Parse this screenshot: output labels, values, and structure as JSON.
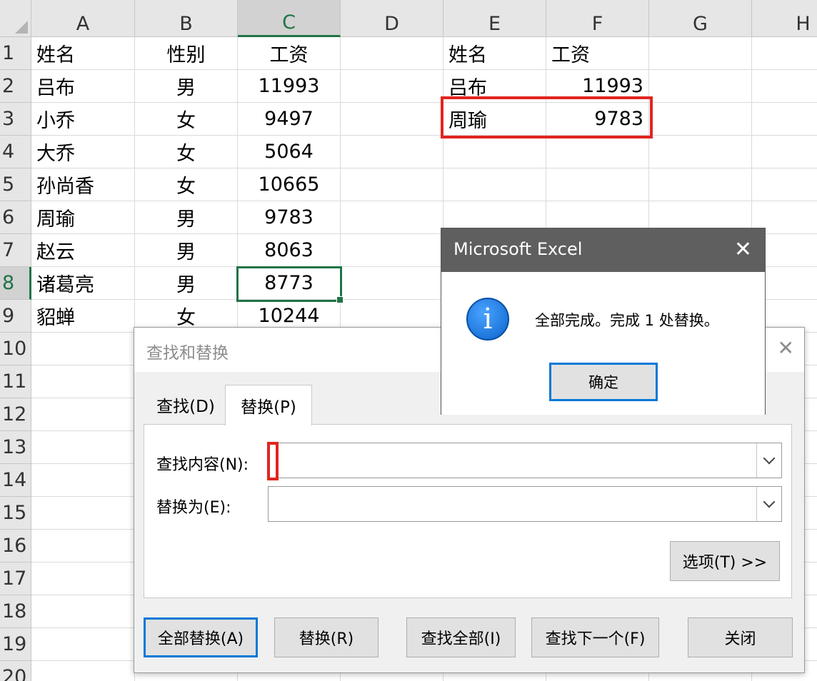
{
  "sheet": {
    "columns": [
      "A",
      "B",
      "C",
      "D",
      "E",
      "F",
      "G",
      "H"
    ],
    "active_column": "C",
    "rows": [
      "1",
      "2",
      "3",
      "4",
      "5",
      "6",
      "7",
      "8",
      "9",
      "10",
      "11",
      "12",
      "13",
      "14",
      "15",
      "16",
      "17",
      "18",
      "19",
      "20"
    ],
    "active_row": "8",
    "table": [
      [
        "姓名",
        "性别",
        "工资"
      ],
      [
        "吕布",
        "男",
        "11993"
      ],
      [
        "小乔",
        "女",
        "9497"
      ],
      [
        "大乔",
        "女",
        "5064"
      ],
      [
        "孙尚香",
        "女",
        "10665"
      ],
      [
        "周瑜",
        "男",
        "9783"
      ],
      [
        "赵云",
        "男",
        "8063"
      ],
      [
        "诸葛亮",
        "男",
        "8773"
      ],
      [
        "貂蝉",
        "女",
        "10244"
      ]
    ],
    "lookup": [
      [
        "姓名",
        "工资"
      ],
      [
        "吕布",
        "11993"
      ],
      [
        "周瑜",
        "9783"
      ]
    ],
    "highlight_color": "#e2241f",
    "selection_color": "#217346"
  },
  "find_replace": {
    "title": "查找和替换",
    "close": "✕",
    "tabs": {
      "find": "查找(D)",
      "replace": "替换(P)"
    },
    "find_label": "查找内容(N):",
    "replace_label": "替换为(E):",
    "find_value": "",
    "replace_value": "",
    "options_button": "选项(T) >>",
    "buttons": {
      "replace_all": "全部替换(A)",
      "replace": "替换(R)",
      "find_all": "查找全部(I)",
      "find_next": "查找下一个(F)",
      "close": "关闭"
    }
  },
  "message_box": {
    "title": "Microsoft Excel",
    "close": "✕",
    "icon": "info-icon",
    "message": "全部完成。完成 1 处替换。",
    "ok": "确定"
  }
}
